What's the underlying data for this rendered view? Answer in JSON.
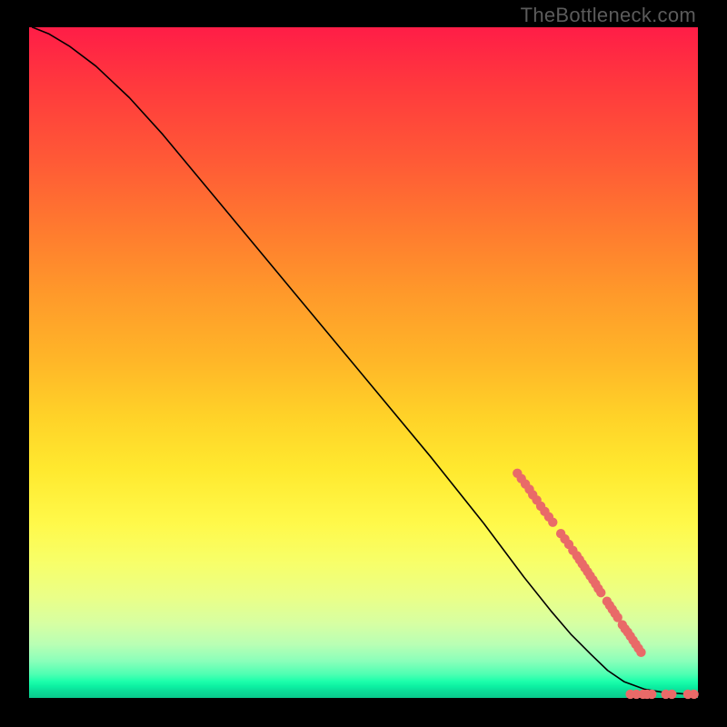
{
  "watermark": "TheBottleneck.com",
  "chart_data": {
    "type": "line",
    "title": "",
    "xlabel": "",
    "ylabel": "",
    "xlim": [
      0,
      100
    ],
    "ylim": [
      0,
      100
    ],
    "background_gradient": {
      "top": "#ff1d47",
      "bottom": "#0ac98c",
      "direction": "vertical"
    },
    "series": [
      {
        "name": "curve",
        "type": "line",
        "color": "#000000",
        "x": [
          0.5,
          3,
          6,
          10,
          15,
          20,
          30,
          40,
          50,
          60,
          68,
          74,
          78,
          81,
          84,
          86.5,
          89,
          92,
          95,
          98,
          100
        ],
        "y": [
          100,
          99,
          97.2,
          94.2,
          89.5,
          84,
          72,
          60,
          48,
          36,
          26,
          18,
          13,
          9.5,
          6.5,
          4.1,
          2.4,
          1.3,
          0.8,
          0.6,
          0.55
        ]
      },
      {
        "name": "highlighted-points",
        "type": "scatter",
        "color": "#e96a68",
        "points": [
          {
            "x": 73.0,
            "y": 33.5
          },
          {
            "x": 73.6,
            "y": 32.7
          },
          {
            "x": 74.2,
            "y": 31.9
          },
          {
            "x": 74.8,
            "y": 31.1
          },
          {
            "x": 75.3,
            "y": 30.3
          },
          {
            "x": 75.9,
            "y": 29.5
          },
          {
            "x": 76.5,
            "y": 28.6
          },
          {
            "x": 77.1,
            "y": 27.8
          },
          {
            "x": 77.7,
            "y": 27.0
          },
          {
            "x": 78.3,
            "y": 26.2
          },
          {
            "x": 79.5,
            "y": 24.5
          },
          {
            "x": 80.1,
            "y": 23.7
          },
          {
            "x": 80.7,
            "y": 22.9
          },
          {
            "x": 81.3,
            "y": 22.0
          },
          {
            "x": 81.9,
            "y": 21.2
          },
          {
            "x": 82.3,
            "y": 20.6
          },
          {
            "x": 82.7,
            "y": 20.0
          },
          {
            "x": 83.1,
            "y": 19.4
          },
          {
            "x": 83.5,
            "y": 18.8
          },
          {
            "x": 83.9,
            "y": 18.2
          },
          {
            "x": 84.3,
            "y": 17.6
          },
          {
            "x": 84.7,
            "y": 17.0
          },
          {
            "x": 85.1,
            "y": 16.3
          },
          {
            "x": 85.5,
            "y": 15.7
          },
          {
            "x": 86.4,
            "y": 14.4
          },
          {
            "x": 86.8,
            "y": 13.8
          },
          {
            "x": 87.2,
            "y": 13.2
          },
          {
            "x": 87.6,
            "y": 12.6
          },
          {
            "x": 88.0,
            "y": 12.0
          },
          {
            "x": 88.7,
            "y": 10.9
          },
          {
            "x": 89.1,
            "y": 10.3
          },
          {
            "x": 89.5,
            "y": 9.8
          },
          {
            "x": 89.9,
            "y": 9.2
          },
          {
            "x": 90.3,
            "y": 8.6
          },
          {
            "x": 90.7,
            "y": 8.0
          },
          {
            "x": 91.1,
            "y": 7.4
          },
          {
            "x": 91.5,
            "y": 6.8
          },
          {
            "x": 89.9,
            "y": 0.55
          },
          {
            "x": 90.8,
            "y": 0.55
          },
          {
            "x": 91.8,
            "y": 0.55
          },
          {
            "x": 92.4,
            "y": 0.55
          },
          {
            "x": 93.1,
            "y": 0.55
          },
          {
            "x": 95.2,
            "y": 0.55
          },
          {
            "x": 96.1,
            "y": 0.55
          },
          {
            "x": 98.5,
            "y": 0.55
          },
          {
            "x": 99.4,
            "y": 0.55
          }
        ]
      }
    ]
  },
  "colors": {
    "curve": "#000000",
    "points": "#e96a68",
    "frame_bg": "#000000",
    "watermark": "#5b5b5b"
  }
}
